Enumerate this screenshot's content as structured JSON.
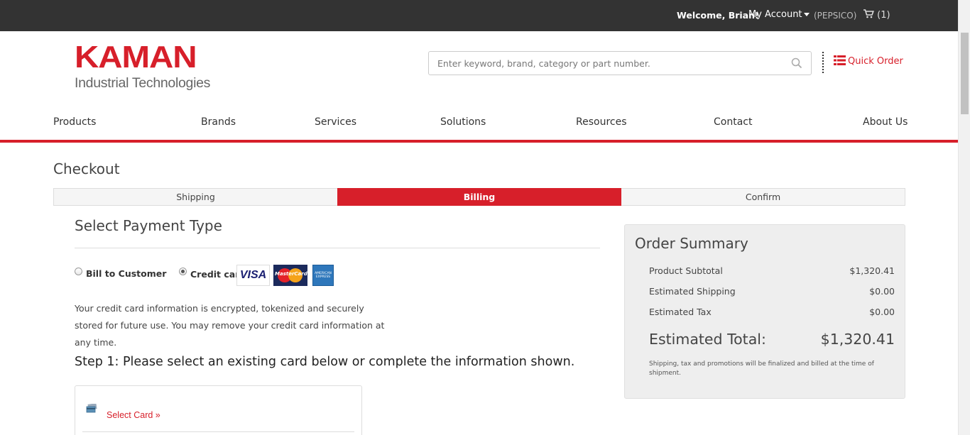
{
  "topbar": {
    "welcome": "Welcome, Brian!",
    "account": "My Account",
    "company": "(PEPSICO)",
    "cart_count": "(1)",
    "cart_icon": "cart-icon"
  },
  "header": {
    "logo_brand": "KAMAN",
    "logo_sub": "Industrial Technologies",
    "search_placeholder": "Enter keyword, brand, category or part number.",
    "quick_order": "Quick Order"
  },
  "nav": [
    "Products",
    "Brands",
    "Services",
    "Solutions",
    "Resources",
    "Contact",
    "About Us"
  ],
  "checkout": {
    "title": "Checkout",
    "steps": [
      "Shipping",
      "Billing",
      "Confirm"
    ],
    "active_step": "Billing"
  },
  "payment": {
    "title": "Select Payment Type",
    "options": [
      "Bill to Customer",
      "Credit card"
    ],
    "selected": "Credit card",
    "cards": {
      "visa": "VISA",
      "mastercard": "MasterCard",
      "amex": "AMERICAN EXPRESS"
    },
    "info": "Your credit card information is encrypted, tokenized and securely stored for future use. You may remove your credit card information at any time.",
    "step1": "Step 1: Please select an existing card below or complete the information shown.",
    "select_card": "Select Card »"
  },
  "summary": {
    "title": "Order Summary",
    "rows": [
      {
        "label": "Product Subtotal",
        "value": "$1,320.41"
      },
      {
        "label": "Estimated Shipping",
        "value": "$0.00"
      },
      {
        "label": "Estimated Tax",
        "value": "$0.00"
      }
    ],
    "total_label": "Estimated Total:",
    "total_value": "$1,320.41",
    "note": "Shipping, tax and promotions will be finalized and billed at the time of shipment."
  },
  "colors": {
    "accent": "#d71f2a",
    "topbar": "#333333",
    "summary_bg": "#eeeeee"
  }
}
